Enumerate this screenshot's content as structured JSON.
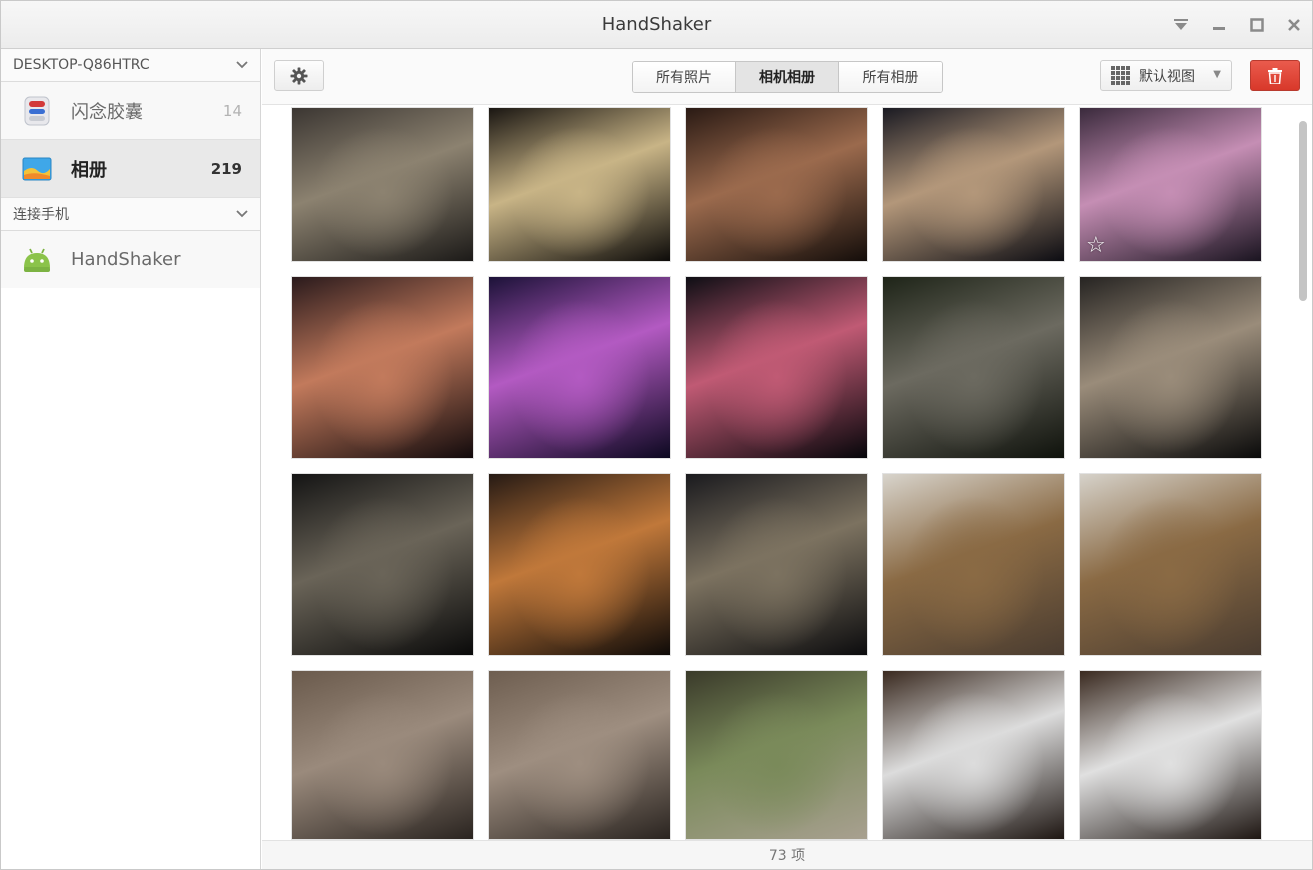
{
  "window": {
    "title": "HandShaker"
  },
  "sidebar": {
    "device_header": "DESKTOP-Q86HTRC",
    "items": [
      {
        "label": "闪念胶囊",
        "count": "14",
        "icon": "capsule-icon"
      },
      {
        "label": "相册",
        "count": "219",
        "icon": "album-icon"
      }
    ],
    "phone_header": "连接手机",
    "phone": {
      "label": "HandShaker",
      "icon": "android-icon"
    }
  },
  "toolbar": {
    "tabs": [
      {
        "label": "所有照片"
      },
      {
        "label": "相机相册",
        "active": true
      },
      {
        "label": "所有相册"
      }
    ],
    "view_mode": "默认视图"
  },
  "photos": [
    {
      "desc": "conference room",
      "colors": [
        "#3b3632",
        "#8c8270",
        "#1c1a18"
      ]
    },
    {
      "desc": "pearl ornaments",
      "colors": [
        "#1a1612",
        "#c8b486",
        "#0d0b09"
      ]
    },
    {
      "desc": "birthday cake",
      "colors": [
        "#2a1a14",
        "#9b6a4d",
        "#140d0a"
      ]
    },
    {
      "desc": "church night",
      "colors": [
        "#1a1a22",
        "#b3977a",
        "#0c0c12"
      ]
    },
    {
      "desc": "mall lights",
      "colors": [
        "#3a2a3c",
        "#c58eb4",
        "#1a1420"
      ],
      "starred": true
    },
    {
      "desc": "mall stage",
      "colors": [
        "#2a1a1c",
        "#c27a5c",
        "#120a0c"
      ]
    },
    {
      "desc": "neon arch",
      "colors": [
        "#1c1238",
        "#b35ac2",
        "#0c0820"
      ]
    },
    {
      "desc": "neon dome",
      "colors": [
        "#0e0e14",
        "#c05a74",
        "#06060a"
      ]
    },
    {
      "desc": "man on phone",
      "colors": [
        "#1e2418",
        "#6c6a60",
        "#0f120c"
      ]
    },
    {
      "desc": "cafe",
      "colors": [
        "#262422",
        "#9a8c7a",
        "#0a0a0a"
      ]
    },
    {
      "desc": "tower night",
      "colors": [
        "#141414",
        "#6a6458",
        "#0a0a0a"
      ]
    },
    {
      "desc": "street neon",
      "colors": [
        "#261a14",
        "#c0783a",
        "#0e0a08"
      ]
    },
    {
      "desc": "tower night 2",
      "colors": [
        "#1a1a1e",
        "#7c7260",
        "#0c0c0e"
      ]
    },
    {
      "desc": "desk lamp",
      "colors": [
        "#d8d4cc",
        "#8a6a44",
        "#4a3c30"
      ]
    },
    {
      "desc": "desk lamp 2",
      "colors": [
        "#d6d2ca",
        "#8a6a44",
        "#4a3c30"
      ]
    },
    {
      "desc": "wood planks",
      "colors": [
        "#6a5a4c",
        "#9a8a7c",
        "#2a2420"
      ]
    },
    {
      "desc": "wood planks 2",
      "colors": [
        "#6e5e50",
        "#9e8e80",
        "#2a2420"
      ]
    },
    {
      "desc": "forest path",
      "colors": [
        "#3a3a2a",
        "#7a8a5a",
        "#a8a090"
      ]
    },
    {
      "desc": "white battery",
      "colors": [
        "#3a2a20",
        "#dcdcdc",
        "#1e1612"
      ]
    },
    {
      "desc": "white battery 2",
      "colors": [
        "#3a2a20",
        "#e0e0e0",
        "#1e1612"
      ]
    }
  ],
  "status": {
    "count_text": "73 项"
  }
}
